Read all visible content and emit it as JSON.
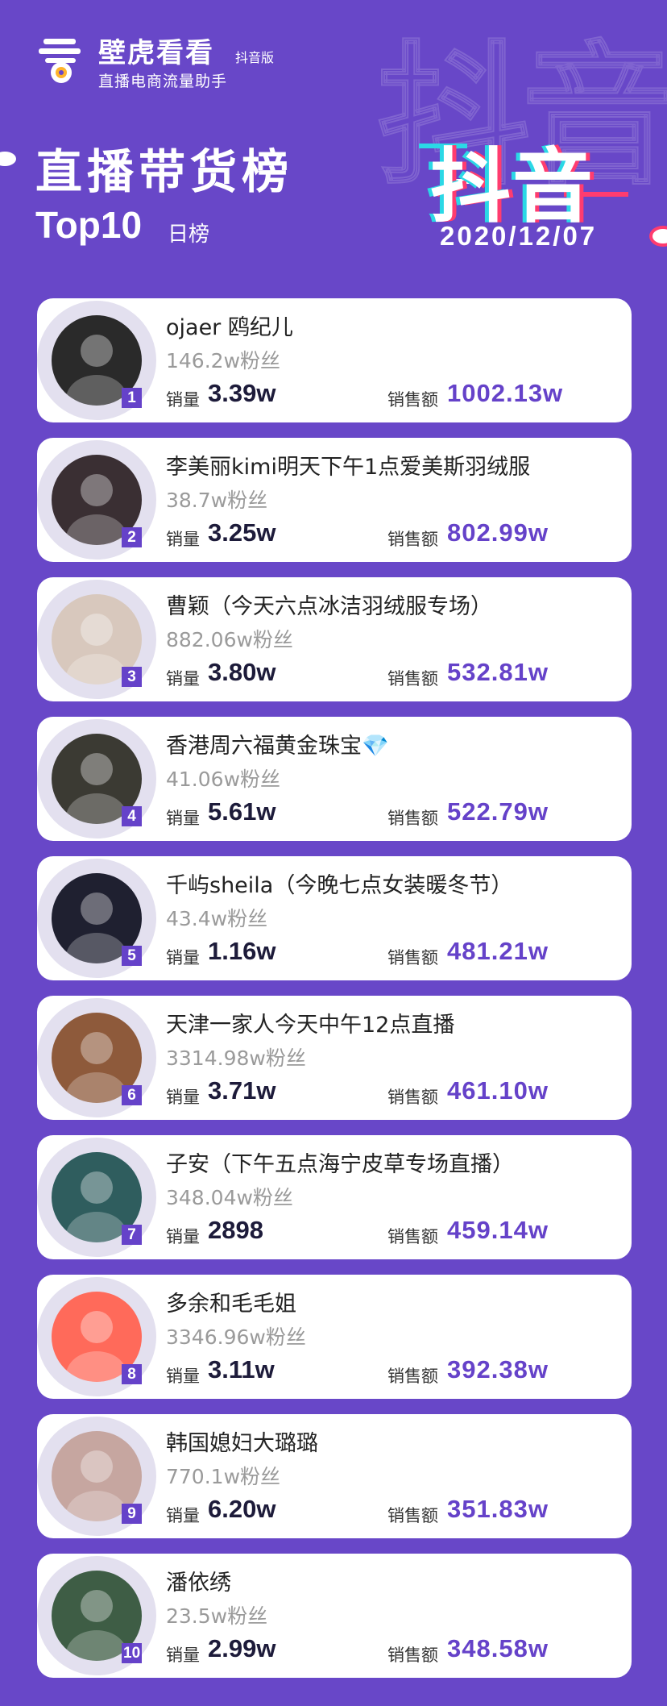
{
  "brand": {
    "name": "壁虎看看",
    "badge": "抖音版",
    "subtitle": "直播电商流量助手",
    "logo_glyph": "看"
  },
  "header": {
    "title": "直播带货榜",
    "top10": "Top10",
    "top10_sub": "日榜",
    "platform": "抖音",
    "date": "2020/12/07"
  },
  "labels": {
    "volume": "销量",
    "amount": "销售额"
  },
  "colors": {
    "background": "#6847c8",
    "accent": "#6542c9",
    "glitch_cyan": "#2bd8e6",
    "glitch_pink": "#ff3c6f"
  },
  "items": [
    {
      "rank": "1",
      "name": "ojaer 鸥纪儿",
      "fans": "146.2w粉丝",
      "volume": "3.39w",
      "amount": "1002.13w",
      "avatar": "galantis-icon"
    },
    {
      "rank": "2",
      "name": "李美丽kimi明天下午1点爱美斯羽绒服",
      "fans": "38.7w粉丝",
      "volume": "3.25w",
      "amount": "802.99w",
      "avatar": "person-icon"
    },
    {
      "rank": "3",
      "name": "曹颖（今天六点冰洁羽绒服专场）",
      "fans": "882.06w粉丝",
      "volume": "3.80w",
      "amount": "532.81w",
      "avatar": "person-icon"
    },
    {
      "rank": "4",
      "name": "香港周六福黄金珠宝💎",
      "fans": "41.06w粉丝",
      "volume": "5.61w",
      "amount": "522.79w",
      "avatar": "store-logo-icon"
    },
    {
      "rank": "5",
      "name": "千屿sheila（今晚七点女装暖冬节）",
      "fans": "43.4w粉丝",
      "volume": "1.16w",
      "amount": "481.21w",
      "avatar": "person-icon"
    },
    {
      "rank": "6",
      "name": "天津一家人今天中午12点直播",
      "fans": "3314.98w粉丝",
      "volume": "3.71w",
      "amount": "461.10w",
      "avatar": "group-icon"
    },
    {
      "rank": "7",
      "name": "子安（下午五点海宁皮草专场直播）",
      "fans": "348.04w粉丝",
      "volume": "2898",
      "amount": "459.14w",
      "avatar": "person-icon"
    },
    {
      "rank": "8",
      "name": "多余和毛毛姐",
      "fans": "3346.96w粉丝",
      "volume": "3.11w",
      "amount": "392.38w",
      "avatar": "person-icon"
    },
    {
      "rank": "9",
      "name": "韩国媳妇大璐璐",
      "fans": "770.1w粉丝",
      "volume": "6.20w",
      "amount": "351.83w",
      "avatar": "group-icon"
    },
    {
      "rank": "10",
      "name": "潘依绣",
      "fans": "23.5w粉丝",
      "volume": "2.99w",
      "amount": "348.58w",
      "avatar": "person-icon"
    }
  ]
}
